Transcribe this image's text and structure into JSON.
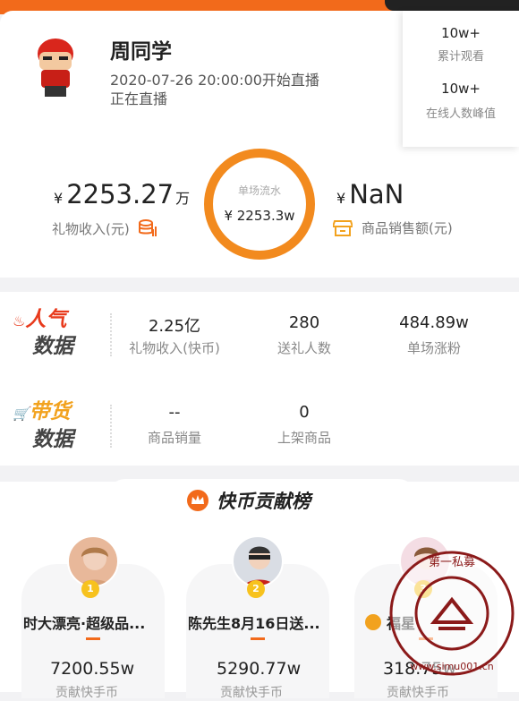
{
  "header": {
    "name": "周同学",
    "live_time": "2020-07-26 20:00:00开始直播",
    "live_status": "正在直播"
  },
  "popover": {
    "total_views": "10w+",
    "total_views_label": "累计观看",
    "peak_online": "10w+",
    "peak_online_label": "在线人数峰值"
  },
  "revenue": {
    "currency": "¥",
    "gift_income": "2253.27",
    "gift_income_unit": "万",
    "gift_income_label": "礼物收入(元)",
    "single_flow_label": "单场流水",
    "single_flow_value": "¥ 2253.3w",
    "goods_sales": "NaN",
    "goods_sales_label": "商品销售额(元)"
  },
  "popularity": {
    "title_line1": "人气",
    "title_line2": "数据",
    "items": [
      {
        "value": "2.25亿",
        "label": "礼物收入(快币)"
      },
      {
        "value": "280",
        "label": "送礼人数"
      },
      {
        "value": "484.89w",
        "label": "单场涨粉"
      }
    ]
  },
  "commerce": {
    "title_line1": "带货",
    "title_line2": "数据",
    "items": [
      {
        "value": "--",
        "label": "商品销量"
      },
      {
        "value": "0",
        "label": "上架商品"
      }
    ]
  },
  "ranking": {
    "title": "快币贡献榜",
    "entries": [
      {
        "rank": "1",
        "name": "时大漂亮·超级品...",
        "value": "7200.55w",
        "label": "贡献快手币"
      },
      {
        "rank": "2",
        "name": "陈先生8月16日送...",
        "value": "5290.77w",
        "label": "贡献快手币"
      },
      {
        "rank": "3",
        "name": "福星",
        "value": "318.75w",
        "label": "贡献快手币"
      }
    ]
  },
  "watermark": {
    "text": "第一私募 www.simu001.cn"
  },
  "colors": {
    "accent": "#f26a1b",
    "ring": "#f28a1e",
    "gold": "#f7c21e"
  }
}
